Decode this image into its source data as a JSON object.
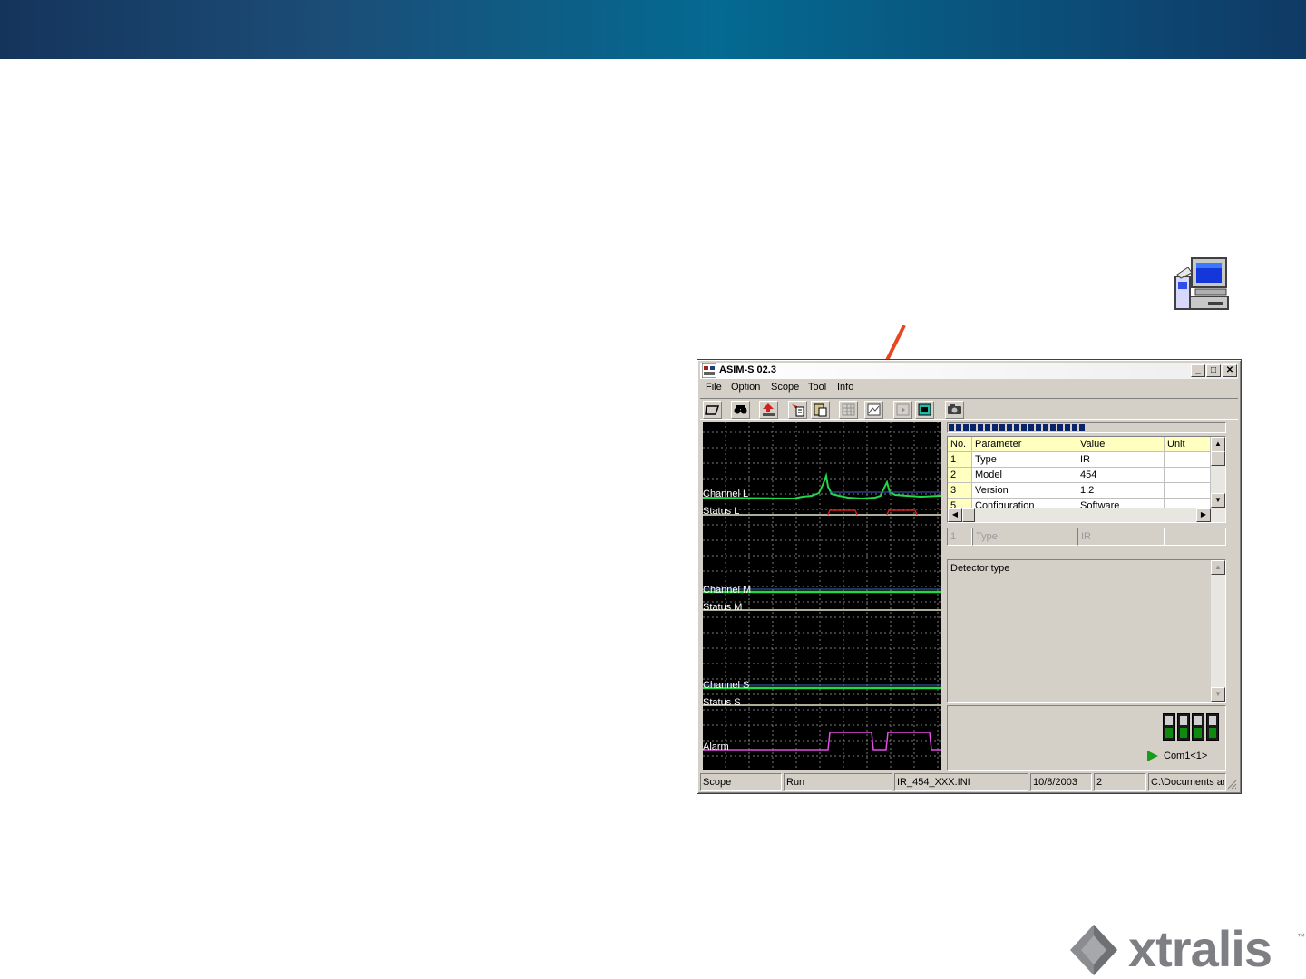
{
  "window": {
    "title": "ASIM-S 02.3"
  },
  "menu": {
    "items": [
      "File",
      "Option",
      "Scope",
      "Tool",
      "Info"
    ]
  },
  "toolbar": {
    "buttons": [
      "open-icon",
      "find-icon",
      "upload-icon",
      "download-icon",
      "paste-icon",
      "grid-icon",
      "chart-icon",
      "play-icon",
      "stop-icon",
      "camera-icon"
    ]
  },
  "scope": {
    "labels": {
      "channel_l": "Channel L",
      "status_l": "Status L",
      "channel_m": "Channel M",
      "status_m": "Status M",
      "channel_s": "Channel S",
      "status_s": "Status S",
      "alarm": "Alarm"
    },
    "colors": {
      "background": "#000000",
      "grid": "#7a7a7a",
      "channel": "#22d84a",
      "status": "#e8e8c8",
      "alarm": "#e64ee6",
      "marker": "#d02020"
    }
  },
  "progress": {
    "fraction": 0.5
  },
  "params": {
    "columns": [
      "No.",
      "Parameter",
      "Value",
      "Unit"
    ],
    "rows": [
      [
        "1",
        "Type",
        "IR",
        ""
      ],
      [
        "2",
        "Model",
        "454",
        ""
      ],
      [
        "3",
        "Version",
        "1.2",
        ""
      ],
      [
        "5",
        "Configuration",
        "Software",
        ""
      ]
    ],
    "edit": [
      "1",
      "Type",
      "IR",
      ""
    ]
  },
  "description": {
    "text": "Detector type"
  },
  "connection": {
    "port": "Com1<1>"
  },
  "statusbar": {
    "panels": [
      "Scope",
      "Run",
      "IR_454_XXX.INI",
      "10/8/2003",
      "2",
      "C:\\Documents ar"
    ]
  },
  "logo": {
    "text": "xtralis",
    "tm": "™"
  }
}
